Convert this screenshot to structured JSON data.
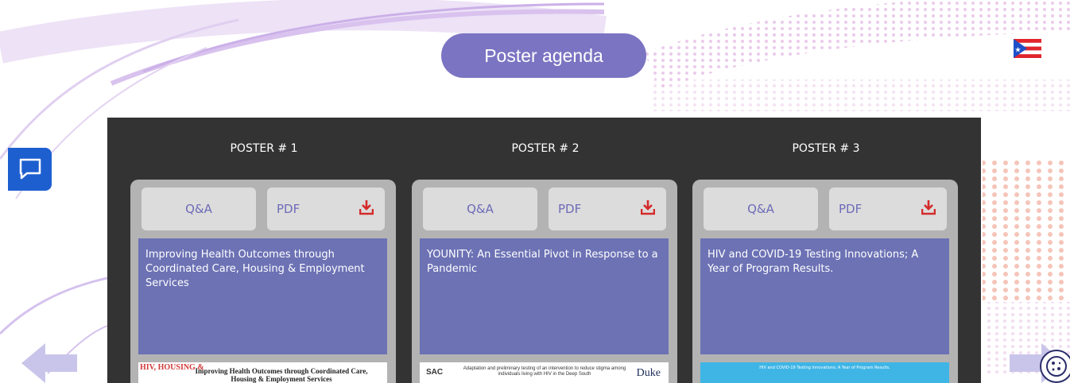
{
  "header": {
    "agenda_button": "Poster agenda"
  },
  "posters": [
    {
      "heading": "POSTER # 1",
      "qa_label": "Q&A",
      "pdf_label": "PDF",
      "description": "Improving Health Outcomes through Coordinated Care, Housing & Employment Services",
      "thumb_logo": "HIV, HOUSING &",
      "thumb_title": "Improving Health Outcomes through Coordinated Care, Housing & Employment Services"
    },
    {
      "heading": "POSTER # 2",
      "qa_label": "Q&A",
      "pdf_label": "PDF",
      "description": "YOUNITY: An Essential Pivot in Response to a Pandemic",
      "thumb_logo": "SAC",
      "thumb_title": "Adaptation and preliminary testing of an intervention to reduce stigma among individuals living with HIV in the Deep South",
      "thumb_right": "Duke"
    },
    {
      "heading": "POSTER # 3",
      "qa_label": "Q&A",
      "pdf_label": "PDF",
      "description": "HIV and COVID-19 Testing Innovations; A Year of Program Results.",
      "thumb_title": "HIV and COVID-19 Testing Innovations; A Year of Program Results."
    }
  ],
  "colors": {
    "accent": "#7b74c2",
    "card_desc": "#6c72b4",
    "download_icon": "#d42a2a",
    "chat": "#1e5fd0",
    "board": "#333333"
  },
  "icons": {
    "chat": "chat-bubble-icon",
    "download": "download-icon",
    "flag": "puerto-rico-flag-icon",
    "prev": "arrow-left-icon",
    "next": "arrow-right-icon",
    "cookie": "cookie-icon"
  }
}
